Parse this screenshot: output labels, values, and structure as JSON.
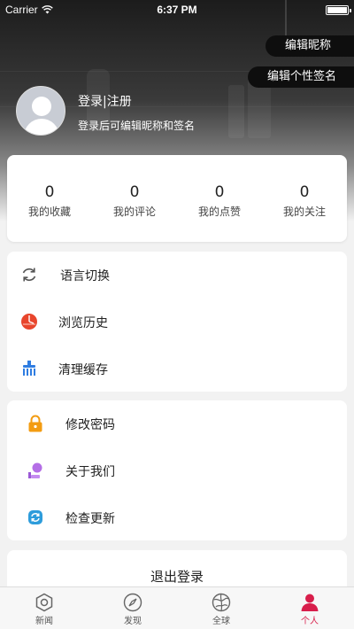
{
  "status_bar": {
    "carrier": "Carrier",
    "time": "6:37 PM"
  },
  "header": {
    "edit_nickname": "编辑昵称",
    "edit_signature": "编辑个性签名",
    "login_title": "登录|注册",
    "login_subtitle": "登录后可编辑昵称和签名"
  },
  "stats": [
    {
      "value": "0",
      "label": "我的收藏"
    },
    {
      "value": "0",
      "label": "我的评论"
    },
    {
      "value": "0",
      "label": "我的点赞"
    },
    {
      "value": "0",
      "label": "我的关注"
    }
  ],
  "menu_group_1": [
    {
      "label": "语言切换",
      "icon": "refresh-icon"
    },
    {
      "label": "浏览历史",
      "icon": "history-icon"
    },
    {
      "label": "清理缓存",
      "icon": "broom-icon"
    }
  ],
  "menu_group_2": [
    {
      "label": "修改密码",
      "icon": "lock-icon"
    },
    {
      "label": "关于我们",
      "icon": "about-icon"
    },
    {
      "label": "检查更新",
      "icon": "update-icon"
    }
  ],
  "logout_label": "退出登录",
  "tabbar": [
    {
      "label": "新闻",
      "icon": "news-icon"
    },
    {
      "label": "发现",
      "icon": "compass-icon"
    },
    {
      "label": "全球",
      "icon": "globe-icon"
    },
    {
      "label": "个人",
      "icon": "person-icon"
    }
  ],
  "colors": {
    "accent": "#d81e4b",
    "header_dark": "#1c1c1c"
  }
}
